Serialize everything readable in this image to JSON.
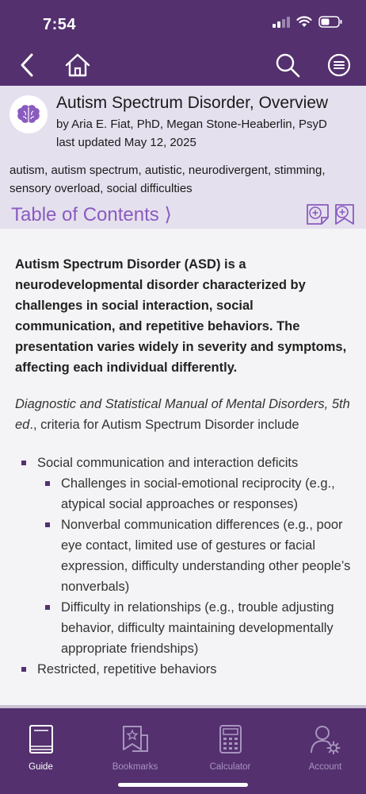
{
  "status": {
    "time": "7:54"
  },
  "nav": {
    "back": "back-icon",
    "home": "home-icon",
    "search": "search-icon",
    "menu": "menu-icon"
  },
  "article": {
    "title": "Autism Spectrum Disorder, Overview",
    "authors": "by Aria E. Fiat, PhD, Megan Stone-Heaberlin, PsyD",
    "updated": "last updated May 12, 2025",
    "keywords": "autism, autism spectrum, autistic, neurodivergent, stimming, sensory overload, social difficulties",
    "toc_label": "Table of Contents ⟩"
  },
  "content": {
    "lead": "Autism Spectrum Disorder (ASD) is a neurodevelopmental disorder characterized by challenges in social interaction, social communication, and repetitive behaviors. The presentation varies widely in severity and symptoms, affecting each individual differently.",
    "intro_italic": "Diagnostic and Statistical Manual of Mental Disorders, 5th ed",
    "intro_rest": "., criteria for Autism Spectrum Disorder include",
    "bullets": [
      {
        "text": "Social communication and interaction deficits",
        "sub": [
          "Challenges in social-emotional reciprocity (e.g., atypical social approaches or responses)",
          "Nonverbal communication differences (e.g., poor eye contact, limited use of gestures or facial expression, difficulty understanding other people’s nonverbals)",
          "Difficulty in relationships (e.g., trouble adjusting behavior, difficulty maintaining developmentally appropriate friendships)"
        ]
      },
      {
        "text": "Restricted, repetitive behaviors",
        "sub": []
      }
    ]
  },
  "tabs": [
    {
      "label": "Guide",
      "icon": "book-icon",
      "active": true
    },
    {
      "label": "Bookmarks",
      "icon": "bookmark-icon",
      "active": false
    },
    {
      "label": "Calculator",
      "icon": "calculator-icon",
      "active": false
    },
    {
      "label": "Account",
      "icon": "account-icon",
      "active": false
    }
  ],
  "colors": {
    "brand": "#54306f",
    "header_bg": "#e5e0ee",
    "accent": "#8a5bbf"
  }
}
